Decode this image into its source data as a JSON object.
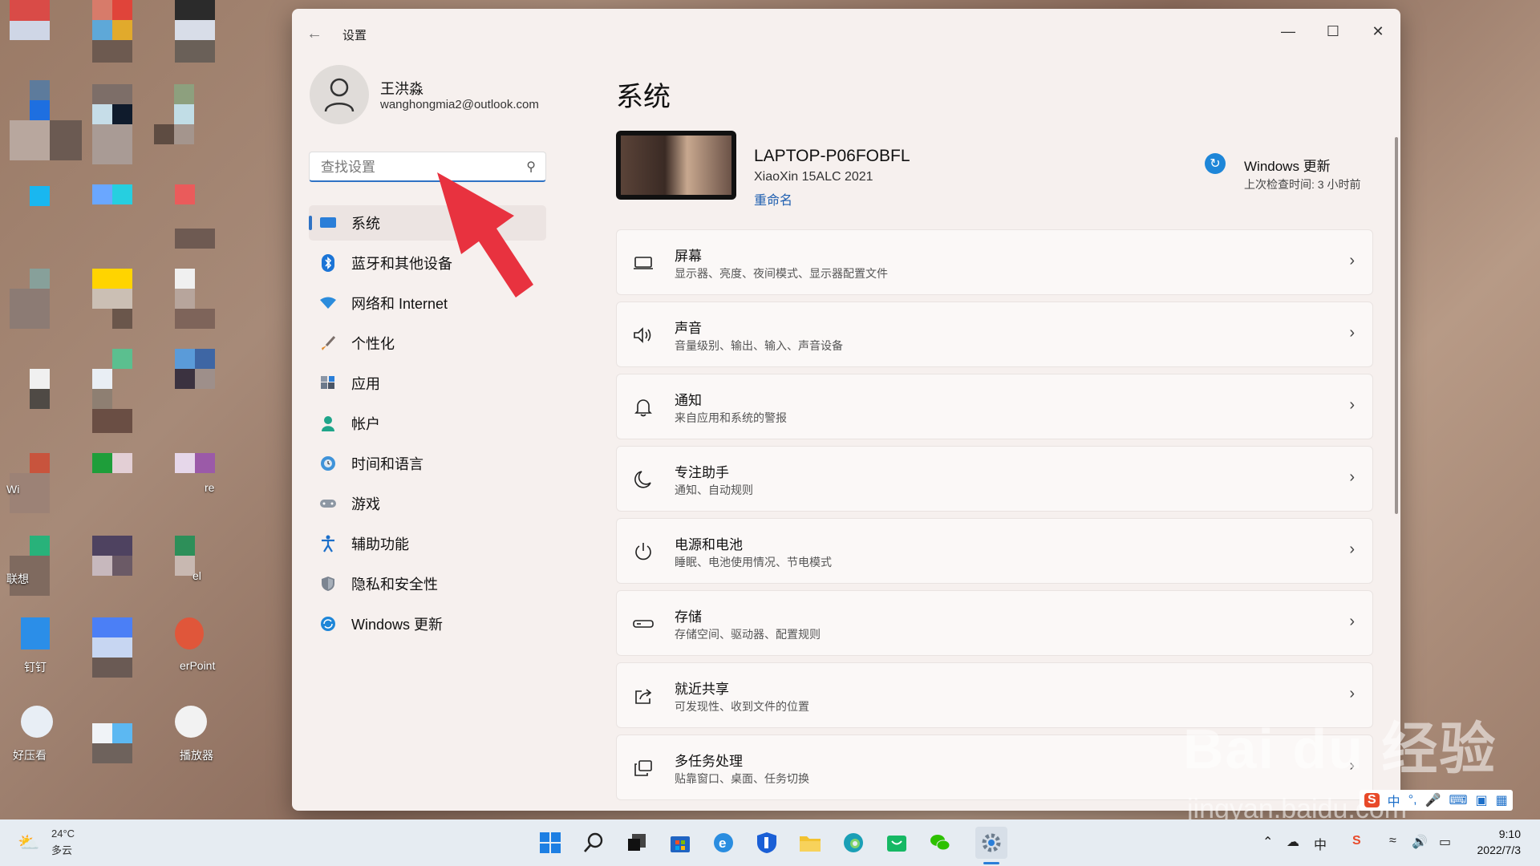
{
  "desktop": {
    "labels": [
      "Wi",
      "联想",
      "钉钉",
      "好压看",
      "re",
      "el",
      "erPoint",
      "播放器"
    ]
  },
  "window": {
    "title": "设置",
    "controls": {
      "minimize": "—",
      "maximize": "☐",
      "close": "✕"
    }
  },
  "user": {
    "name": "王洪淼",
    "email": "wanghongmia2@outlook.com"
  },
  "search": {
    "placeholder": "查找设置"
  },
  "sidebar": {
    "items": [
      {
        "label": "系统",
        "icon": "monitor-icon"
      },
      {
        "label": "蓝牙和其他设备",
        "icon": "bluetooth-icon"
      },
      {
        "label": "网络和 Internet",
        "icon": "wifi-icon"
      },
      {
        "label": "个性化",
        "icon": "brush-icon"
      },
      {
        "label": "应用",
        "icon": "apps-icon"
      },
      {
        "label": "帐户",
        "icon": "person-icon"
      },
      {
        "label": "时间和语言",
        "icon": "globe-clock-icon"
      },
      {
        "label": "游戏",
        "icon": "gamepad-icon"
      },
      {
        "label": "辅助功能",
        "icon": "accessibility-icon"
      },
      {
        "label": "隐私和安全性",
        "icon": "shield-icon"
      },
      {
        "label": "Windows 更新",
        "icon": "update-icon"
      }
    ]
  },
  "main": {
    "title": "系统",
    "device": {
      "name": "LAPTOP-P06FOBFL",
      "model": "XiaoXin 15ALC 2021",
      "rename": "重命名"
    },
    "update": {
      "title": "Windows 更新",
      "subtitle": "上次检查时间: 3 小时前"
    },
    "cards": [
      {
        "title": "屏幕",
        "subtitle": "显示器、亮度、夜间模式、显示器配置文件",
        "icon": "display-icon"
      },
      {
        "title": "声音",
        "subtitle": "音量级别、输出、输入、声音设备",
        "icon": "speaker-icon"
      },
      {
        "title": "通知",
        "subtitle": "来自应用和系统的警报",
        "icon": "bell-icon"
      },
      {
        "title": "专注助手",
        "subtitle": "通知、自动规则",
        "icon": "moon-icon"
      },
      {
        "title": "电源和电池",
        "subtitle": "睡眠、电池使用情况、节电模式",
        "icon": "power-icon"
      },
      {
        "title": "存储",
        "subtitle": "存储空间、驱动器、配置规则",
        "icon": "storage-icon"
      },
      {
        "title": "就近共享",
        "subtitle": "可发现性、收到文件的位置",
        "icon": "share-icon"
      },
      {
        "title": "多任务处理",
        "subtitle": "贴靠窗口、桌面、任务切换",
        "icon": "multitask-icon"
      }
    ]
  },
  "taskbar": {
    "weather_temp": "24°C",
    "weather_desc": "多云",
    "time": "9:10",
    "date": "2022/7/3",
    "ime_lang": "中"
  },
  "watermark": {
    "logo": "Bai du 经验",
    "url": "jingyan.baidu.com"
  }
}
